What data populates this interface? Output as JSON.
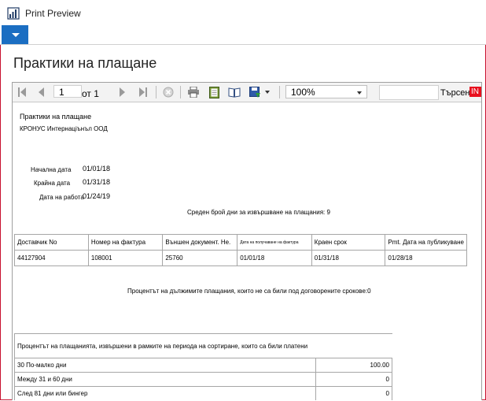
{
  "window": {
    "title": "Print Preview"
  },
  "page": {
    "title": "Практики на плащане"
  },
  "toolbar": {
    "page_number": "1",
    "of_label": "от 1",
    "zoom": "100%",
    "search_label": "Търсене",
    "search_flag": "IN"
  },
  "report": {
    "title": "Практики на плащане",
    "company": "КРОНУС Интернаціънъл ООД",
    "start_label": "Начална дата",
    "start_value": "01/01/18",
    "end_label": "Крайна дата",
    "end_value": "01/31/18",
    "work_label": "Дата на работа",
    "work_value": "01/24/19",
    "avg_text": "Среден брой дни за извършване на плащания: 9",
    "columns": [
      "Доставчик No",
      "Номер на фактура",
      "Външен документ. Не.",
      "Дата на получаване на фактура",
      "Краен срок",
      "Pmt. Дата на публикуване"
    ],
    "row": [
      "44127904",
      "108001",
      "25760",
      "01/01/18",
      "01/31/18",
      "01/28/18"
    ],
    "overdue_text": "Процентът на дължимите плащания, които не са били под договорените срокове:0",
    "pct_header": "Процентът на плащанията, извършени в рамките на периода на сортиране, които са били платени",
    "pct_rows": [
      {
        "label": "30 По-малко дни",
        "value": "100.00"
      },
      {
        "label": "Между 31 и 60 дни",
        "value": "0"
      },
      {
        "label": "След 81 дни или бингер",
        "value": "0"
      }
    ]
  }
}
